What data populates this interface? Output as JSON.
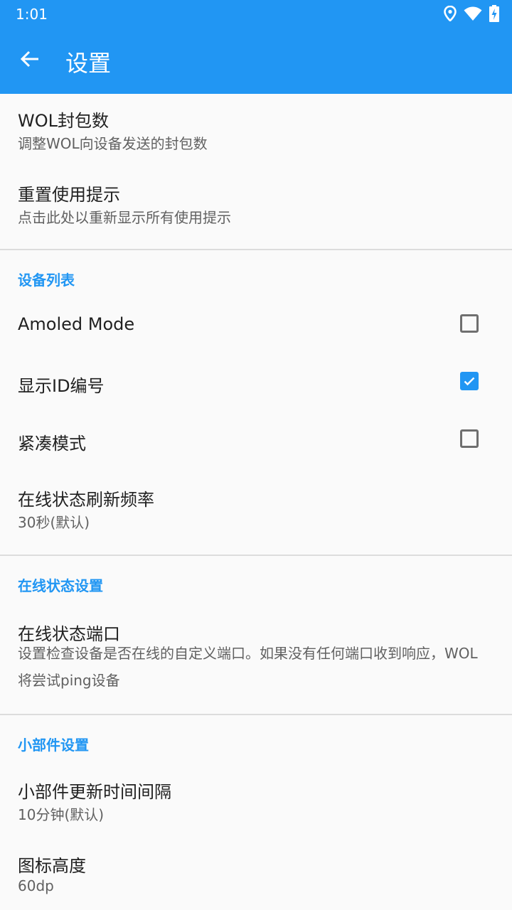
{
  "status_bar": {
    "time": "1:01",
    "icons": [
      "location-icon",
      "wifi-icon",
      "battery-charging-icon"
    ]
  },
  "toolbar": {
    "title": "设置",
    "back_icon": "arrow-back-icon"
  },
  "colors": {
    "primary": "#2196f3",
    "background": "#fafafa"
  },
  "items": {
    "wol_packets": {
      "title": "WOL封包数",
      "summary": "调整WOL向设备发送的封包数"
    },
    "reset_hints": {
      "title": "重置使用提示",
      "summary": "点击此处以重新显示所有使用提示"
    }
  },
  "device_list": {
    "header": "设备列表",
    "amoled": {
      "title": "Amoled Mode",
      "checked": false
    },
    "show_id": {
      "title": "显示ID编号",
      "checked": true
    },
    "compact": {
      "title": "紧凑模式",
      "checked": false
    },
    "refresh_rate": {
      "title": "在线状态刷新频率",
      "summary": "30秒(默认)"
    }
  },
  "online_status": {
    "header": "在线状态设置",
    "port": {
      "title": "在线状态端口",
      "summary": "设置检查设备是否在线的自定义端口。如果没有任何端口收到响应，WOL将尝试ping设备"
    }
  },
  "widget": {
    "header": "小部件设置",
    "update_interval": {
      "title": "小部件更新时间间隔",
      "summary": "10分钟(默认)"
    },
    "icon_height": {
      "title": "图标高度",
      "summary": "60dp"
    }
  }
}
